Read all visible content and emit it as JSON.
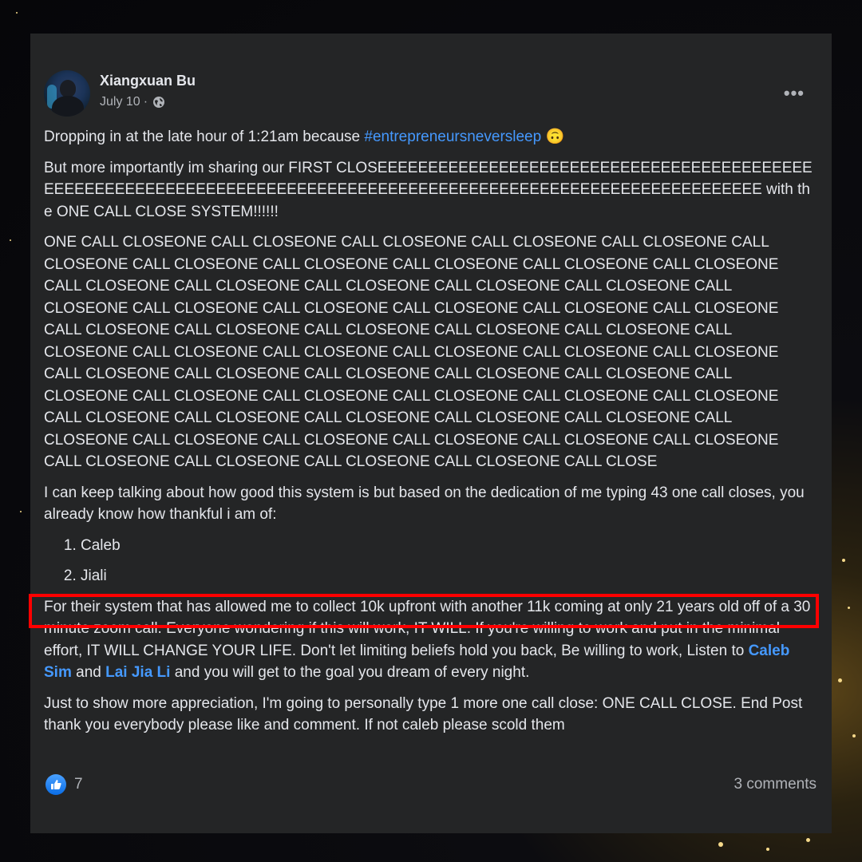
{
  "post": {
    "author": "Xiangxuan Bu",
    "date": "July 10",
    "meta_separator": "·",
    "more_icon": "more-horizontal-icon",
    "privacy_icon": "globe-icon",
    "p1_text": "Dropping in at the late hour of 1:21am because ",
    "p1_hashtag": "#entrepreneursneversleep",
    "p1_emoji": "🙃",
    "p2_text": "But more importantly im sharing our FIRST CLOSEEEEEEEEEEEEEEEEEEEEEEEEEEEEEEEEEEEEEEEEEEEEEEEEEEEEEEEEEEEEEEEEEEEEEEEEEEEEEEEEEEEEEEEEEEEEEEEEEEEEEEEEEEEEEEEEEE with the ONE CALL CLOSE SYSTEM!!!!!!",
    "p3_text": "ONE CALL CLOSEONE CALL CLOSEONE CALL CLOSEONE CALL CLOSEONE CALL CLOSEONE CALL CLOSEONE CALL CLOSEONE CALL CLOSEONE CALL CLOSEONE CALL CLOSEONE CALL CLOSEONE CALL CLOSEONE CALL CLOSEONE CALL CLOSEONE CALL CLOSEONE CALL CLOSEONE CALL CLOSEONE CALL CLOSEONE CALL CLOSEONE CALL CLOSEONE CALL CLOSEONE CALL CLOSEONE CALL CLOSEONE CALL CLOSEONE CALL CLOSEONE CALL CLOSEONE CALL CLOSEONE CALL CLOSEONE CALL CLOSEONE CALL CLOSEONE CALL CLOSEONE CALL CLOSEONE CALL CLOSEONE CALL CLOSEONE CALL CLOSEONE CALL CLOSEONE CALL CLOSEONE CALL CLOSEONE CALL CLOSEONE CALL CLOSEONE CALL CLOSEONE CALL CLOSEONE CALL CLOSEONE CALL CLOSEONE CALL CLOSEONE CALL CLOSEONE CALL CLOSEONE CALL CLOSEONE CALL CLOSEONE CALL CLOSEONE CALL CLOSEONE CALL CLOSEONE CALL CLOSEONE CALL CLOSEONE CALL CLOSEONE CALL CLOSEONE CALL CLOSEONE CALL CLOSEONE CALL CLOSEONE CALL CLOSE",
    "p4_text": "I can keep talking about how good this system is but based on the dedication of me typing 43 one call closes, you already know how thankful i am of:",
    "list": [
      "Caleb",
      "Jiali"
    ],
    "p5_text_a": "For their system that has allowed me to collect 10k upfront with another 11k coming at only 21 years old off of a 30 minute zoom call. Everyone wondering if this will work, IT WILL. If you're willing to work and put in the minimal effort, IT WILL CHANGE YOUR LIFE. Don't let limiting beliefs hold you back, Be willing to work, Listen to ",
    "p5_mention_1": "Caleb Sim",
    "p5_text_b": " and ",
    "p5_mention_2": "Lai Jia Li",
    "p5_text_c": " and you will get to the goal you dream of every night.",
    "p6_text": "Just to show more appreciation, I'm going to personally type 1 more one call close: ONE CALL CLOSE. End Post thank you everybody please like and comment. If not caleb please scold them",
    "reactions_icon": "like-icon",
    "reaction_count": "7",
    "comments_label": "3 comments"
  },
  "colors": {
    "card_bg": "#242526",
    "text": "#e4e6eb",
    "muted": "#b0b3b8",
    "link": "#4599ff",
    "highlight": "#ff0000"
  }
}
